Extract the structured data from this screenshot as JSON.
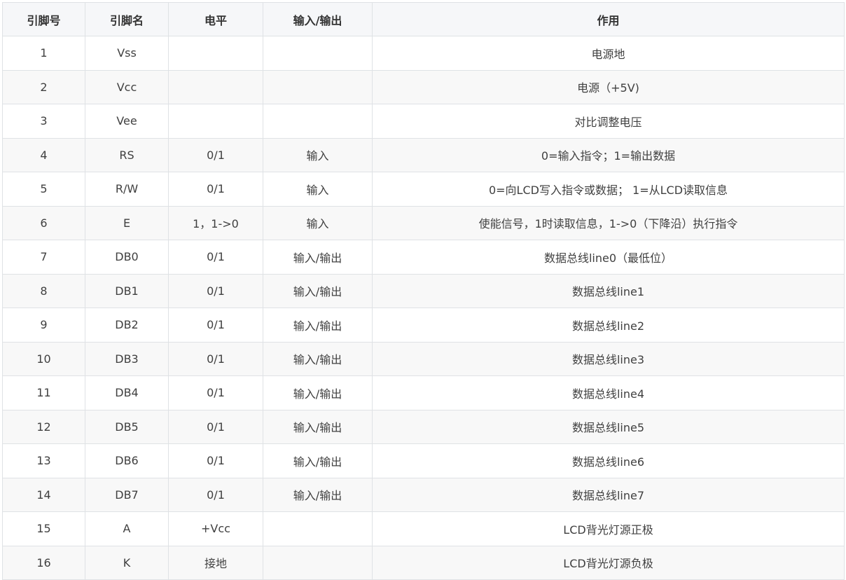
{
  "table": {
    "headers": [
      "引脚号",
      "引脚名",
      "电平",
      "输入/输出",
      "作用"
    ],
    "rows": [
      [
        "1",
        "Vss",
        "",
        "",
        "电源地"
      ],
      [
        "2",
        "Vcc",
        "",
        "",
        "电源（+5V)"
      ],
      [
        "3",
        "Vee",
        "",
        "",
        "对比调整电压"
      ],
      [
        "4",
        "RS",
        "0/1",
        "输入",
        "0=输入指令；1=输出数据"
      ],
      [
        "5",
        "R/W",
        "0/1",
        "输入",
        "0=向LCD写入指令或数据； 1=从LCD读取信息"
      ],
      [
        "6",
        "E",
        "1，1->0",
        "输入",
        "使能信号，1时读取信息，1->0（下降沿）执行指令"
      ],
      [
        "7",
        "DB0",
        "0/1",
        "输入/输出",
        "数据总线line0（最低位）"
      ],
      [
        "8",
        "DB1",
        "0/1",
        "输入/输出",
        "数据总线line1"
      ],
      [
        "9",
        "DB2",
        "0/1",
        "输入/输出",
        "数据总线line2"
      ],
      [
        "10",
        "DB3",
        "0/1",
        "输入/输出",
        "数据总线line3"
      ],
      [
        "11",
        "DB4",
        "0/1",
        "输入/输出",
        "数据总线line4"
      ],
      [
        "12",
        "DB5",
        "0/1",
        "输入/输出",
        "数据总线line5"
      ],
      [
        "13",
        "DB6",
        "0/1",
        "输入/输出",
        "数据总线line6"
      ],
      [
        "14",
        "DB7",
        "0/1",
        "输入/输出",
        "数据总线line7"
      ],
      [
        "15",
        "A",
        "+Vcc",
        "",
        "LCD背光灯源正极"
      ],
      [
        "16",
        "K",
        "接地",
        "",
        "LCD背光灯源负极"
      ]
    ]
  }
}
